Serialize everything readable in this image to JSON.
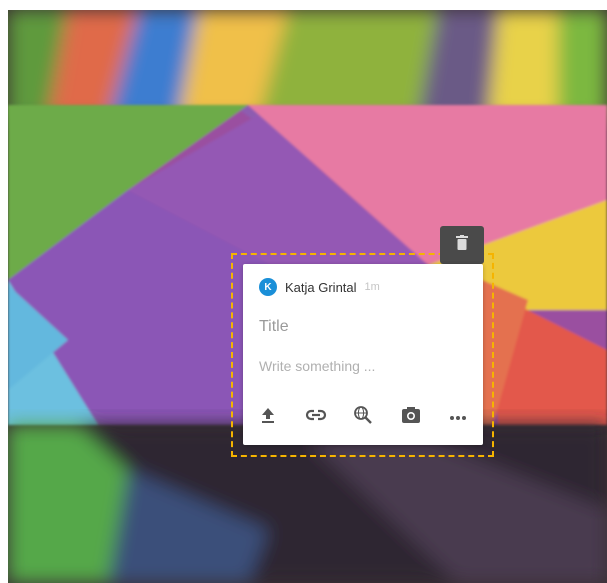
{
  "note": {
    "author_initial": "K",
    "author_name": "Katja Grintal",
    "timestamp": "1m",
    "title_placeholder": "Title",
    "body_placeholder": "Write something ..."
  },
  "toolbar": {
    "icons": [
      "upload-icon",
      "link-icon",
      "web-search-icon",
      "camera-icon",
      "more-icon"
    ]
  },
  "colors": {
    "accent": "#1a8fd8",
    "selection_border": "#f5b400",
    "delete_button_bg": "#4a4a4a"
  }
}
